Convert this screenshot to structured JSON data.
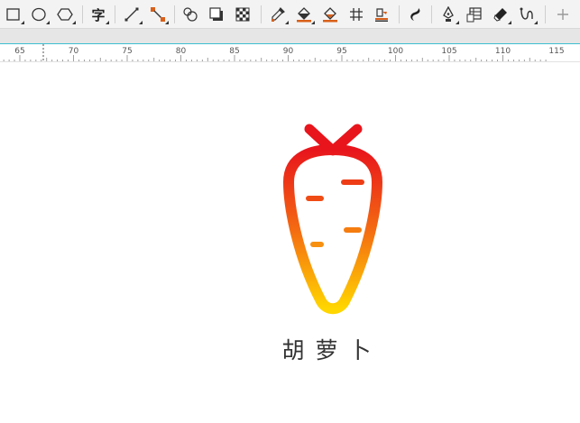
{
  "toolbar": {
    "tools": [
      {
        "name": "rectangle-tool-icon"
      },
      {
        "name": "ellipse-tool-icon"
      },
      {
        "name": "polygon-tool-icon"
      },
      {
        "name": "text-tool-icon",
        "label": "字"
      },
      {
        "name": "line-tool-icon"
      },
      {
        "name": "connector-tool-icon"
      },
      {
        "name": "blend-tool-icon"
      },
      {
        "name": "drop-shadow-tool-icon"
      },
      {
        "name": "transparency-tool-icon"
      },
      {
        "name": "eyedropper-tool-icon"
      },
      {
        "name": "fill-tool-icon"
      },
      {
        "name": "smart-fill-tool-icon"
      },
      {
        "name": "mesh-fill-tool-icon"
      },
      {
        "name": "interactive-fill-tool-icon"
      },
      {
        "name": "artistic-media-tool-icon"
      },
      {
        "name": "pen-tool-icon"
      },
      {
        "name": "table-tool-icon"
      },
      {
        "name": "eraser-tool-icon"
      },
      {
        "name": "smudge-tool-icon"
      },
      {
        "name": "add-tool-icon"
      }
    ]
  },
  "ruler": {
    "labels": [
      "65",
      "70",
      "75",
      "80",
      "85",
      "90",
      "95",
      "100",
      "105",
      "110",
      "115"
    ]
  },
  "logo": {
    "text": "胡萝卜",
    "colors": {
      "top": "#e8151c",
      "middle": "#f46a12",
      "bottom": "#ffd600"
    }
  }
}
